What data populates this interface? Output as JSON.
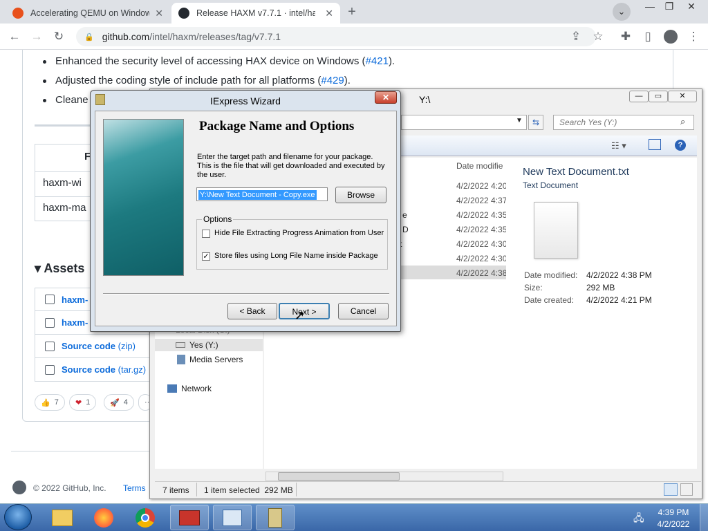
{
  "browser": {
    "tabs": [
      {
        "title": "Accelerating QEMU on Windows",
        "active": false
      },
      {
        "title": "Release HAXM v7.7.1 · intel/haxm",
        "active": true
      }
    ],
    "url_host": "github.com",
    "url_path": "/intel/haxm/releases/tag/v7.7.1"
  },
  "github": {
    "bullets": [
      {
        "text": "Enhanced the security level of accessing HAX device on Windows (",
        "link": "#421",
        "tail": ")."
      },
      {
        "text": "Adjusted the coding style of include path for all platforms (",
        "link": "#429",
        "tail": ")."
      },
      {
        "text": "Cleane",
        "link": "",
        "tail": ""
      }
    ],
    "table_rows": [
      "haxm-wi",
      "haxm-ma"
    ],
    "table_header": "F",
    "assets_title": "Assets",
    "assets": [
      {
        "name": "haxm-",
        "suffix": ""
      },
      {
        "name": "haxm-",
        "suffix": ""
      },
      {
        "name": "Source code",
        "suffix": "(zip)"
      },
      {
        "name": "Source code",
        "suffix": "(tar.gz)"
      }
    ],
    "reactions": [
      {
        "emoji": "👍",
        "count": "7"
      },
      {
        "emoji": "❤",
        "count": "1"
      },
      {
        "emoji": "🚀",
        "count": "4"
      }
    ],
    "footer_copyright": "© 2022 GitHub, Inc.",
    "footer_terms": "Terms"
  },
  "explorer": {
    "title": "Y:\\",
    "search_placeholder": "Search Yes (Y:)",
    "column_date": "Date modifie",
    "dates": [
      "4/2/2022 4:20",
      "4/2/2022 4:37",
      "4/2/2022 4:35",
      "4/2/2022 4:35",
      "4/2/2022 4:30",
      "4/2/2022 4:30",
      "4/2/2022 4:38"
    ],
    "name_fragments": [
      "e",
      "D",
      "t"
    ],
    "nav_items": [
      "Yes (Y:)",
      "Media Servers",
      "Network"
    ],
    "nav_partial": "Local Disk (C:)",
    "details": {
      "filename": "New Text Document.txt",
      "filetype": "Text Document",
      "rows": [
        {
          "label": "Date modified:",
          "value": "4/2/2022 4:38 PM"
        },
        {
          "label": "Size:",
          "value": "292 MB"
        },
        {
          "label": "Date created:",
          "value": "4/2/2022 4:21 PM"
        }
      ]
    },
    "status_items": "7 items",
    "status_selected": "1 item selected  292 MB"
  },
  "wizard": {
    "title": "IExpress Wizard",
    "heading": "Package Name and Options",
    "description": "Enter the target path and filename for your package. This is the file that will get downloaded and executed by the user.",
    "path_value": "Y:\\New Text Document - Copy.exe",
    "browse_label": "Browse",
    "options_label": "Options",
    "option1": "Hide File Extracting Progress Animation from User",
    "option1_checked": false,
    "option2": "Store files using Long File Name inside Package",
    "option2_checked": true,
    "back_label": "< Back",
    "next_label": "Next >",
    "cancel_label": "Cancel"
  },
  "taskbar": {
    "time": "4:39 PM",
    "date": "4/2/2022"
  }
}
